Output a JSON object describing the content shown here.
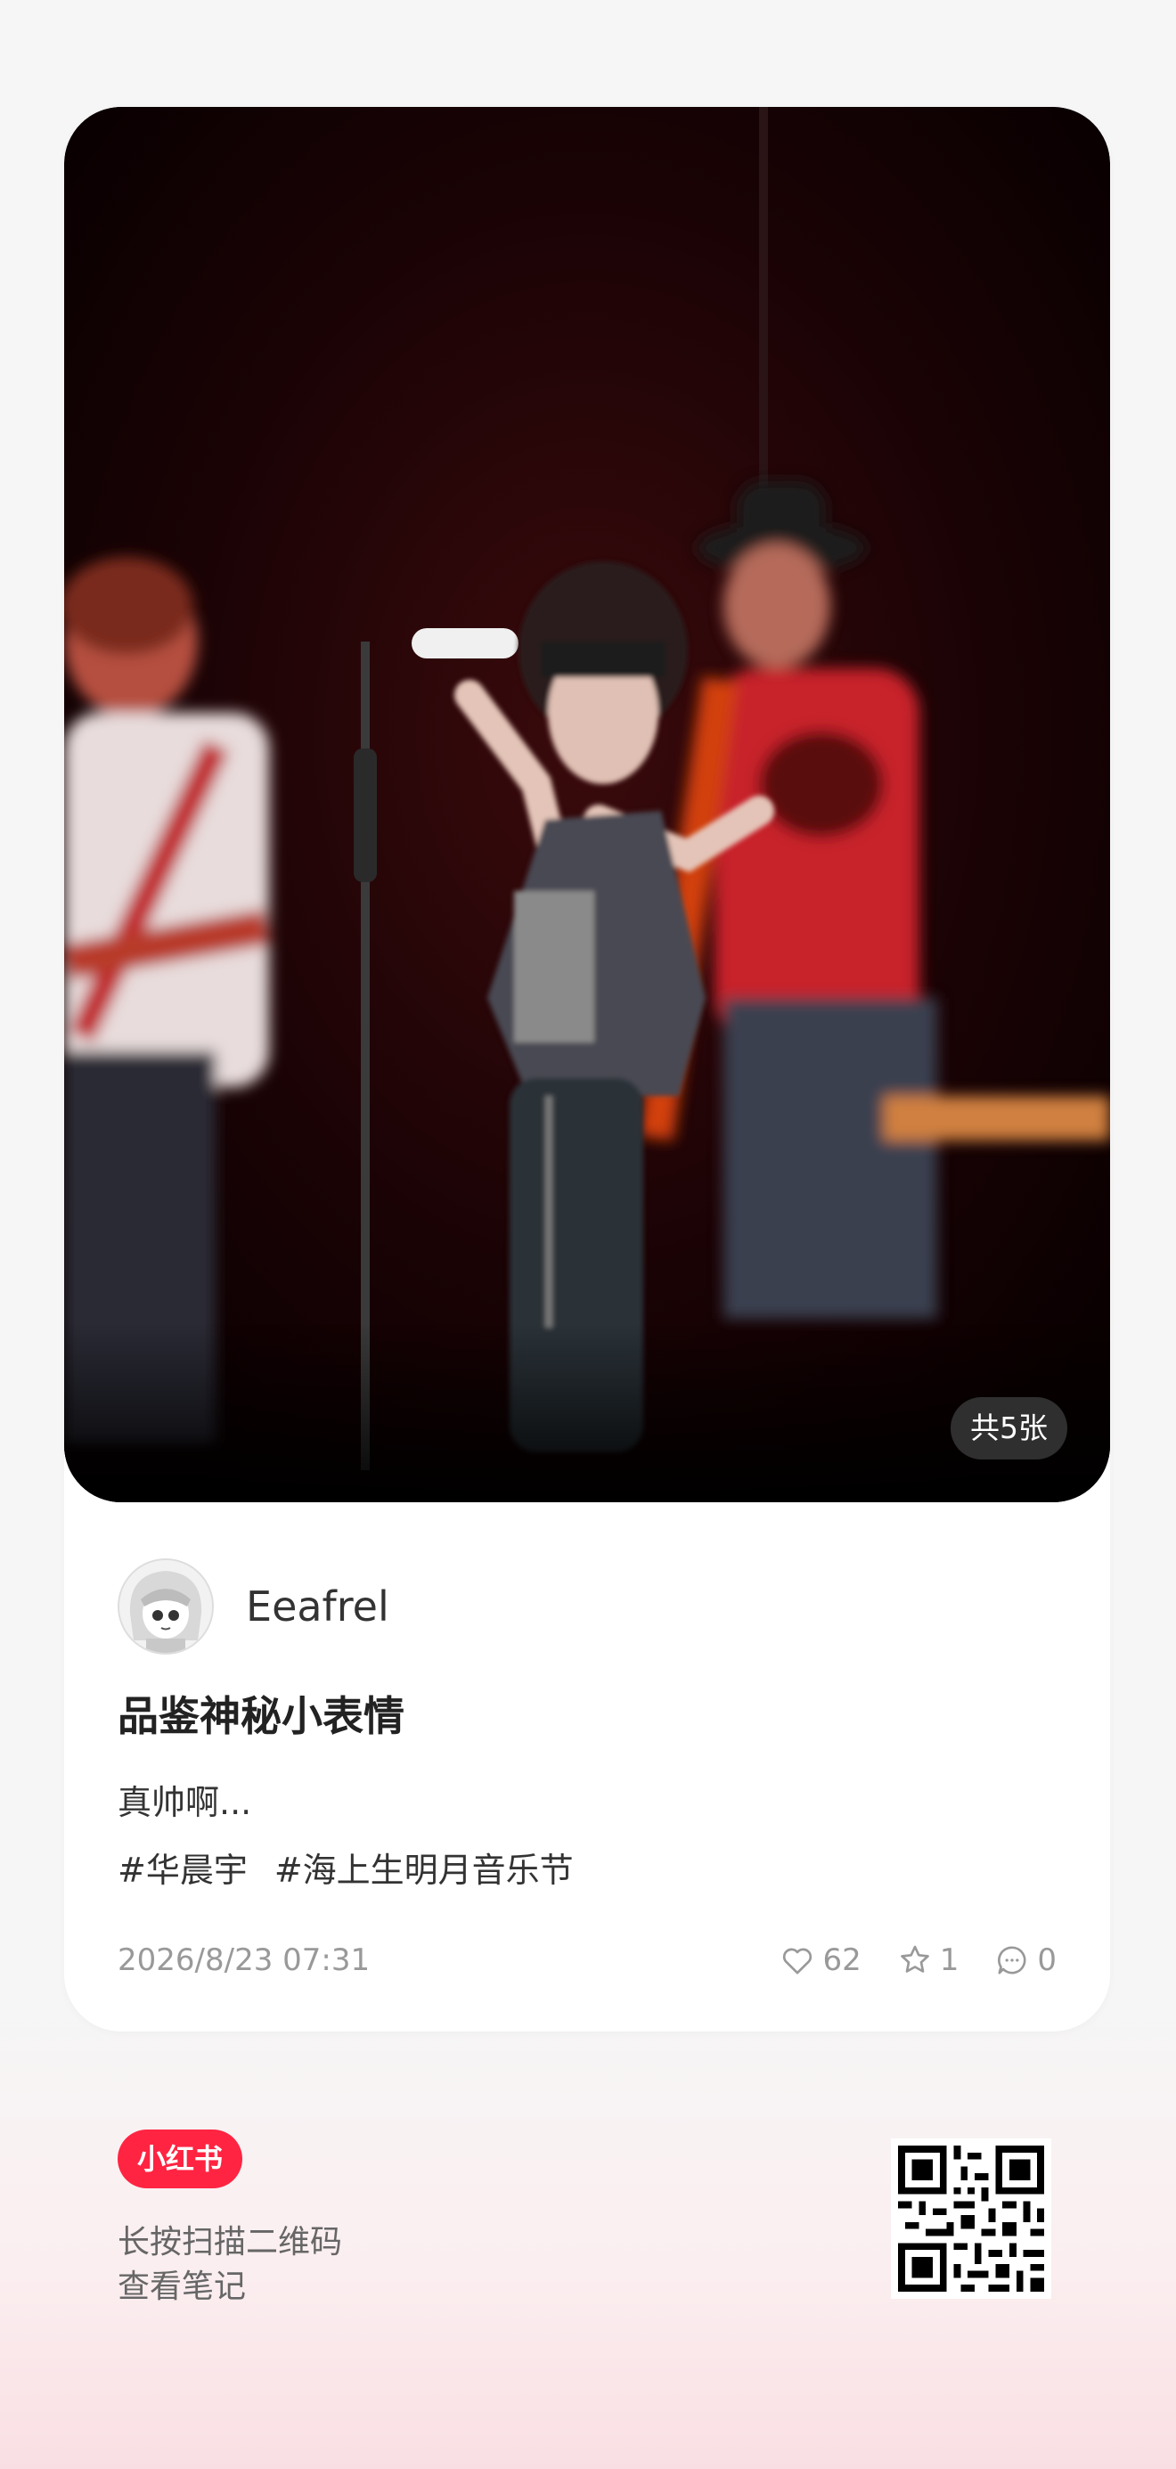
{
  "photo": {
    "count_label": "共5张"
  },
  "author": {
    "name": "Eeafrel"
  },
  "note": {
    "title": "品鉴神秘小表情",
    "body": "真帅啊...",
    "tags": [
      "#华晨宇",
      "#海上生明月音乐节"
    ],
    "date": "2026/8/23 07:31"
  },
  "stats": {
    "likes": "62",
    "favorites": "1",
    "comments": "0"
  },
  "footer": {
    "brand": "小红书",
    "line1": "长按扫描二维码",
    "line2": "查看笔记"
  },
  "colors": {
    "brand_red": "#ff2442",
    "stage_dark": "#120203"
  }
}
